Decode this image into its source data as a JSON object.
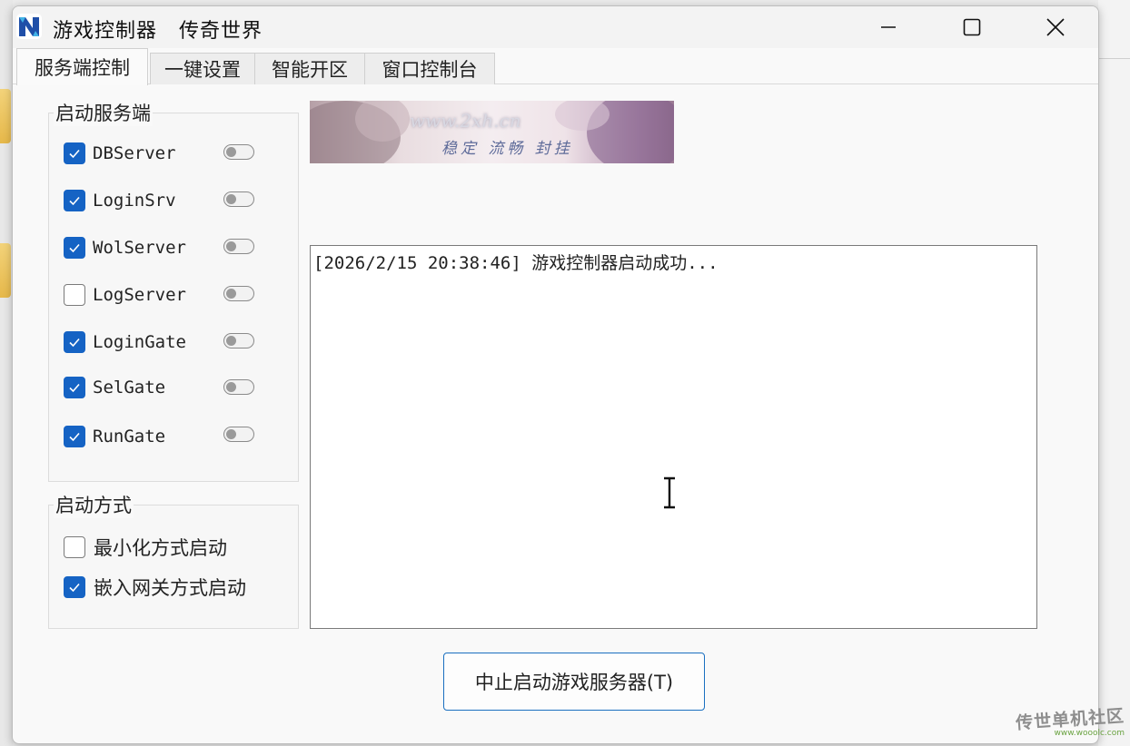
{
  "window": {
    "title": "游戏控制器   传奇世界"
  },
  "tabs": [
    {
      "label": "服务端控制",
      "active": true
    },
    {
      "label": "一键设置",
      "active": false
    },
    {
      "label": "智能开区",
      "active": false
    },
    {
      "label": "窗口控制台",
      "active": false
    }
  ],
  "start_server_group": {
    "title": "启动服务端",
    "servers": [
      {
        "label": "DBServer",
        "checked": true,
        "toggle_on": false
      },
      {
        "label": "LoginSrv",
        "checked": true,
        "toggle_on": false
      },
      {
        "label": "WolServer",
        "checked": true,
        "toggle_on": false
      },
      {
        "label": "LogServer",
        "checked": false,
        "toggle_on": false
      },
      {
        "label": "LoginGate",
        "checked": true,
        "toggle_on": false
      },
      {
        "label": "SelGate",
        "checked": true,
        "toggle_on": false
      },
      {
        "label": "RunGate",
        "checked": true,
        "toggle_on": false
      }
    ]
  },
  "start_mode_group": {
    "title": "启动方式",
    "options": [
      {
        "label": "最小化方式启动",
        "checked": false
      },
      {
        "label": "嵌入网关方式启动",
        "checked": true
      }
    ]
  },
  "banner": {
    "line1": "www.2xh.cn",
    "line2": "稳定 流畅 封挂"
  },
  "log": {
    "lines": [
      "[2026/2/15 20:38:46] 游戏控制器启动成功..."
    ]
  },
  "stop_button": {
    "label": "中止启动游戏服务器(T)"
  },
  "watermark": {
    "line1": "传世单机社区",
    "line2": "www.wooolc.com"
  },
  "colors": {
    "accent": "#1563c4",
    "button_border": "#1a6fc0"
  }
}
